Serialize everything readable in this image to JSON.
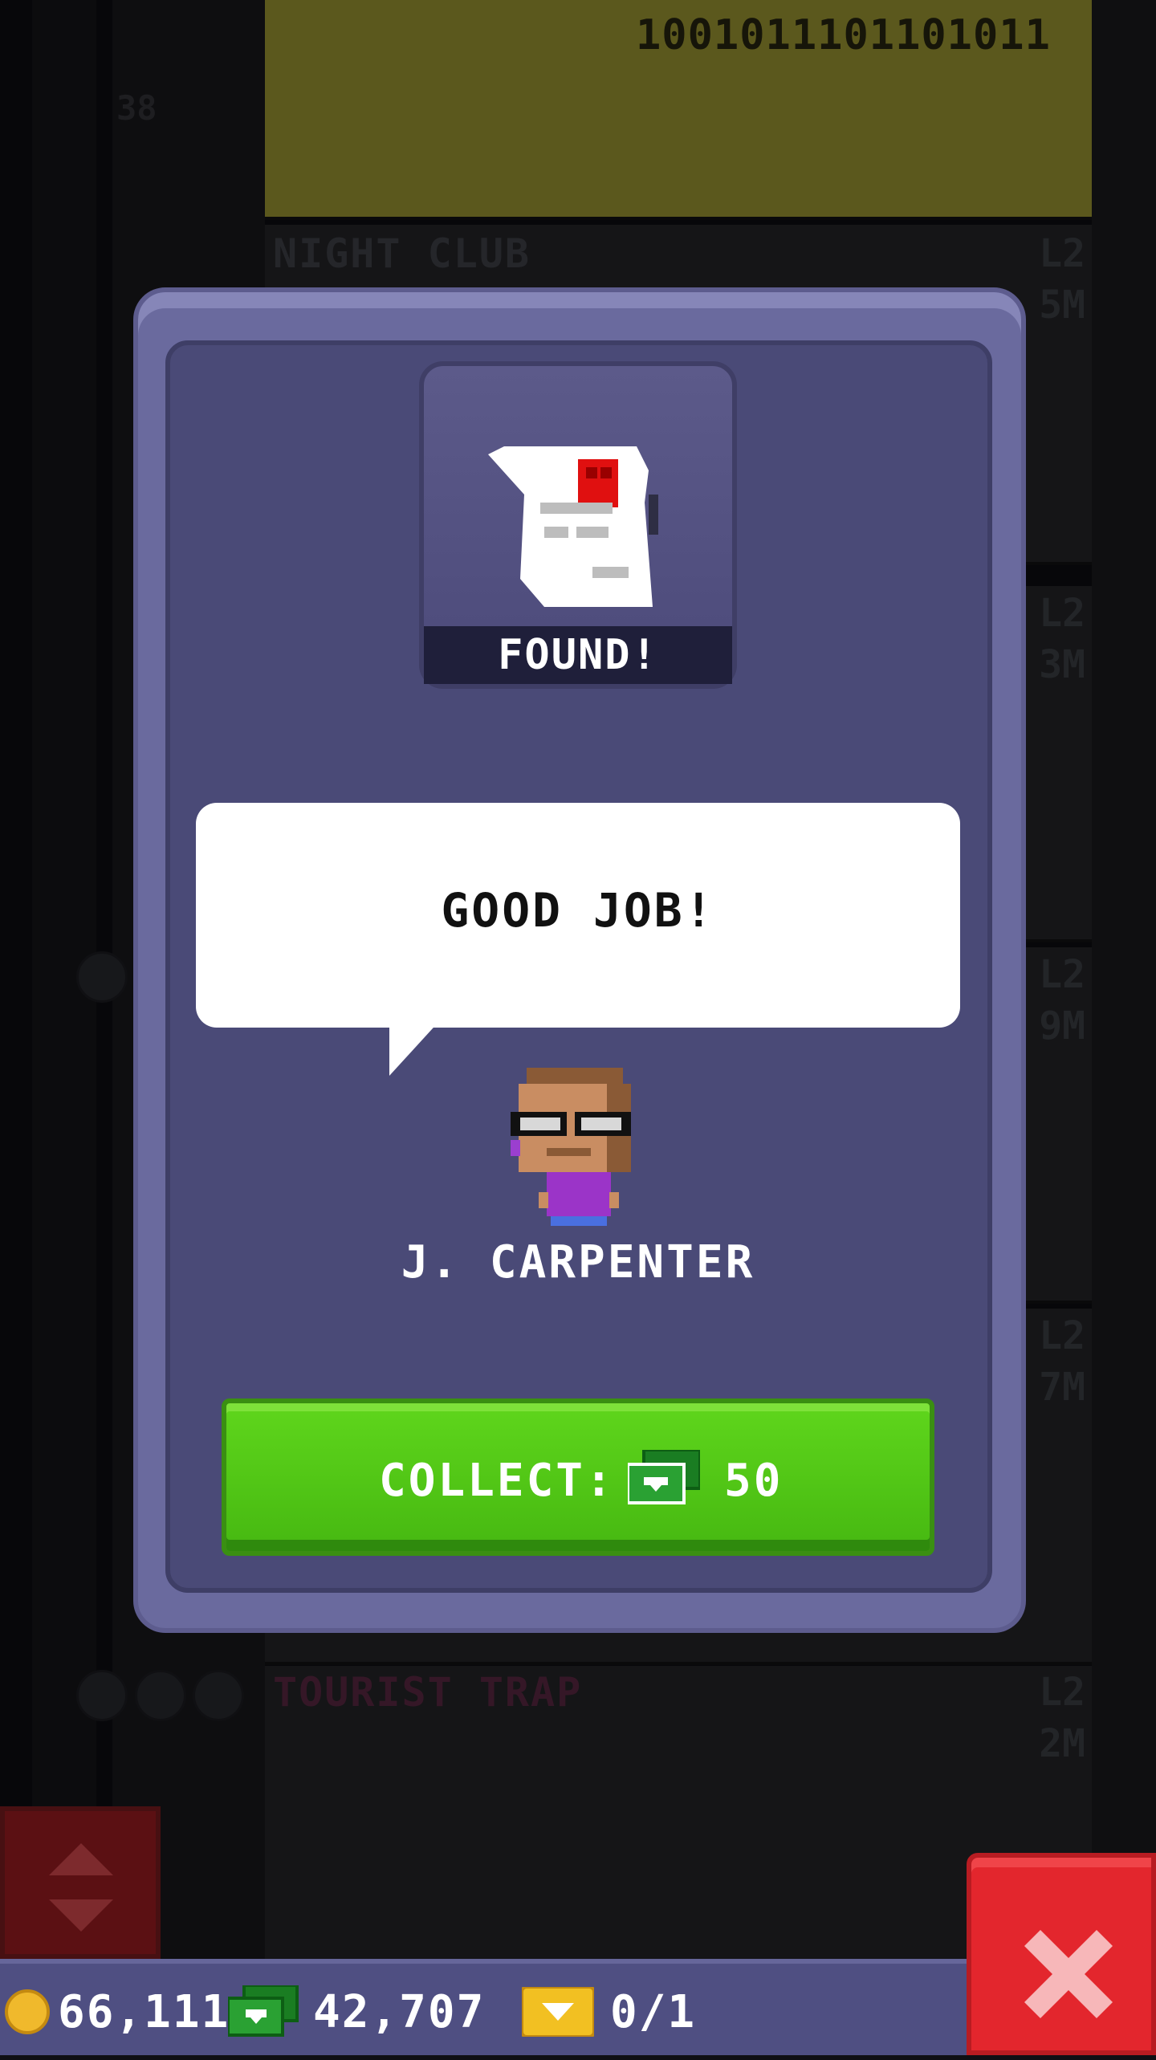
{
  "background": {
    "binary_display": "1001011101101011",
    "floor_number": "38",
    "floors": [
      {
        "name": "NIGHT CLUB",
        "level": "L2",
        "earnings": "5M"
      },
      {
        "name": "",
        "level": "L2",
        "earnings": "3M"
      },
      {
        "name": "",
        "level": "L2",
        "earnings": "9M"
      },
      {
        "name": "",
        "level": "L2",
        "earnings": "7M"
      },
      {
        "name": "TOURIST TRAP",
        "level": "L2",
        "earnings": "2M"
      }
    ]
  },
  "modal": {
    "item_status": "FOUND!",
    "speech": "GOOD JOB!",
    "character_name": "J. CARPENTER",
    "collect_label": "COLLECT:",
    "collect_value": "50"
  },
  "hud": {
    "coins": "66,111",
    "bux": "42,707",
    "tickets": "0/1"
  },
  "colors": {
    "collect_green": "#4fc417",
    "close_red": "#e3262d",
    "modal_purple": "#4a4a77"
  }
}
